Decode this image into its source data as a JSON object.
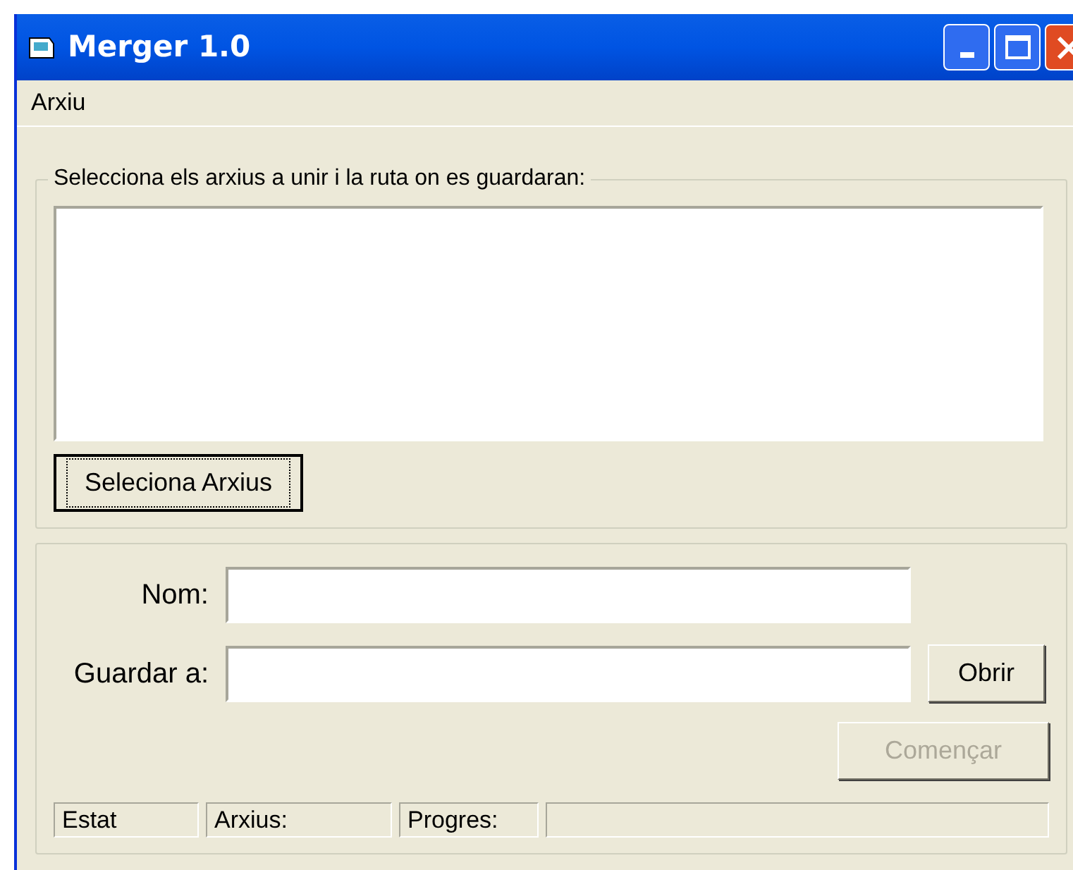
{
  "window": {
    "title": "Merger 1.0"
  },
  "menu": [
    {
      "label": "Arxiu"
    }
  ],
  "files_group": {
    "label": "Selecciona els arxius a unir i la ruta on es guardaran:",
    "select_button": {
      "label": "Seleciona Arxius",
      "focused": true
    }
  },
  "fields": [
    {
      "label": "Nom:"
    },
    {
      "label": "Guardar a:"
    }
  ],
  "open_button": {
    "label": "Obrir",
    "disabled": false
  },
  "start_button": {
    "label": "Començar",
    "disabled": true
  },
  "status_bar": [
    {
      "text": "Estat"
    },
    {
      "text": "Arxius:"
    },
    {
      "text": "Progres:"
    }
  ],
  "progress": {
    "level": 0
  }
}
